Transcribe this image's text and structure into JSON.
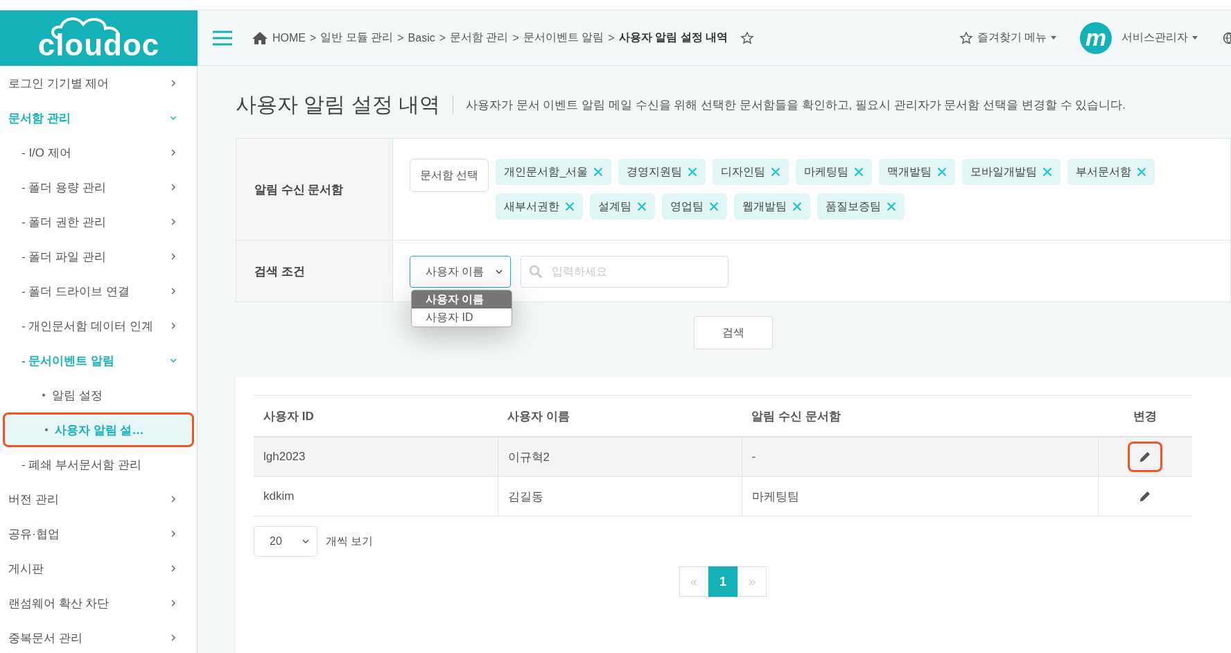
{
  "logo": "cloudoc",
  "header": {
    "breadcrumb": [
      {
        "label": "HOME"
      },
      {
        "separator": ">",
        "label": "일반 모듈 관리"
      },
      {
        "separator": ">",
        "label": "Basic"
      },
      {
        "separator": ">",
        "label": "문서함 관리"
      },
      {
        "separator": ">",
        "label": "문서이벤트 알림"
      },
      {
        "separator": ">",
        "label": "사용자 알림 설정 내역"
      }
    ],
    "favorites": "즐겨찾기 메뉴",
    "avatar": "m",
    "user": "서비스관리자"
  },
  "sidebar": {
    "items": [
      {
        "kind": "group",
        "label": "로그인 기기별 제어",
        "expanded": false,
        "selected": false,
        "callout": false
      },
      {
        "kind": "group",
        "label": "문서함 관리",
        "expanded": true,
        "selected": false,
        "callout": false,
        "children": [
          {
            "kind": "group",
            "label": "- I/O 제어",
            "expanded": false,
            "selected": false,
            "callout": false
          },
          {
            "kind": "group",
            "label": "- 폴더 용량 관리",
            "expanded": false,
            "selected": false,
            "callout": false
          },
          {
            "kind": "group",
            "label": "- 폴더 권한 관리",
            "expanded": false,
            "selected": false,
            "callout": false
          },
          {
            "kind": "group",
            "label": "- 폴더 파일 관리",
            "expanded": false,
            "selected": false,
            "callout": false
          },
          {
            "kind": "group",
            "label": "- 폴더 드라이브 연결",
            "expanded": false,
            "selected": false,
            "callout": false
          },
          {
            "kind": "group",
            "label": "- 개인문서함 데이터 인계",
            "expanded": false,
            "selected": false,
            "callout": false
          },
          {
            "kind": "group",
            "label": "- 문서이벤트 알림",
            "expanded": true,
            "selected": false,
            "callout": false,
            "children": [
              {
                "kind": "subpage",
                "label": "알림 설정",
                "selected": false,
                "callout": false
              },
              {
                "kind": "subpage",
                "label": "사용자 알림 설…",
                "selected": true,
                "callout": true
              }
            ]
          },
          {
            "kind": "link",
            "label": "- 폐쇄 부서문서함 관리",
            "selected": false,
            "callout": false
          }
        ]
      },
      {
        "kind": "group",
        "label": "버전 관리",
        "expanded": false,
        "selected": false,
        "callout": false
      },
      {
        "kind": "group",
        "label": "공유·협업",
        "expanded": false,
        "selected": false,
        "callout": false
      },
      {
        "kind": "group",
        "label": "게시판",
        "expanded": false,
        "selected": false,
        "callout": false
      },
      {
        "kind": "group",
        "label": "랜섬웨어 확산 차단",
        "expanded": false,
        "selected": false,
        "callout": false
      },
      {
        "kind": "group",
        "label": "중복문서 관리",
        "expanded": false,
        "selected": false,
        "callout": false
      }
    ]
  },
  "page": {
    "title": "사용자 알림 설정 내역",
    "description": "사용자가 문서 이벤트 알림 메일 수신을 위해 선택한 문서함들을 확인하고, 필요시 관리자가 문서함 선택을 변경할 수 있습니다."
  },
  "filter": {
    "folders_label": "알림 수신 문서함",
    "choose_button": "문서함 선택",
    "tags": [
      "개인문서함_서울",
      "경영지원팀",
      "디자인팀",
      "마케팅팀",
      "맥개발팀",
      "모바일개발팀",
      "부서문서함",
      "새부서권한",
      "설계팀",
      "영업팀",
      "웹개발팀",
      "품질보증팀"
    ],
    "condition_label": "검색 조건",
    "select": {
      "value": "사용자 이름",
      "expanded": true,
      "options": [
        {
          "label": "사용자 이름",
          "selected": true
        },
        {
          "label": "사용자 ID",
          "selected": false
        }
      ]
    },
    "search": {
      "placeholder": "입력하세요"
    },
    "search_button": "검색"
  },
  "table": {
    "columns": [
      "사용자 ID",
      "사용자 이름",
      "알림 수신 문서함",
      "변경"
    ],
    "rows": [
      {
        "cells": [
          "lgh2023",
          "이규혁2",
          "-"
        ],
        "highlighted": true,
        "callout": true
      },
      {
        "cells": [
          "kdkim",
          "김길동",
          "마케팅팀"
        ],
        "highlighted": false,
        "callout": false
      }
    ]
  },
  "page_size": {
    "value": "20",
    "label": "개씩 보기"
  },
  "pagination": {
    "prev": "«",
    "next": "»",
    "pages": [
      {
        "label": "1",
        "selected": true
      }
    ]
  }
}
